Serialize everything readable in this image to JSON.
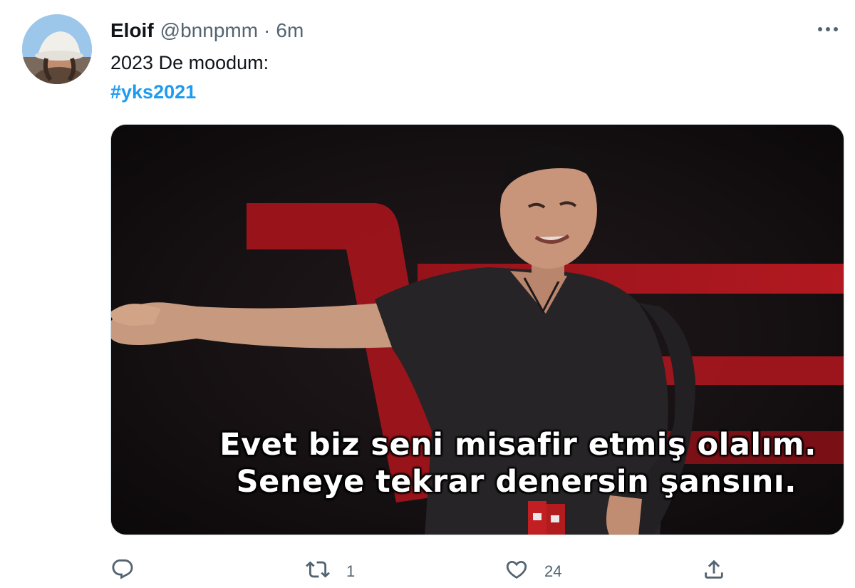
{
  "tweet": {
    "display_name": "Eloif",
    "handle": "@bnnpmm",
    "separator": "·",
    "timestamp": "6m",
    "text": "2023 De moodum:",
    "hashtag": "#yks2021",
    "media": {
      "caption_line1": "Evet biz seni misafir etmiş olalım.",
      "caption_line2": "Seneye tekrar denersin şansını."
    },
    "actions": {
      "reply_icon": "reply-icon",
      "retweet_icon": "retweet-icon",
      "retweet_count": "1",
      "like_icon": "heart-icon",
      "like_count": "24",
      "share_icon": "share-icon"
    },
    "more_icon": "more-icon"
  },
  "colors": {
    "text_primary": "#0f1419",
    "text_secondary": "#536471",
    "link": "#1d9bf0",
    "background": "#ffffff"
  }
}
